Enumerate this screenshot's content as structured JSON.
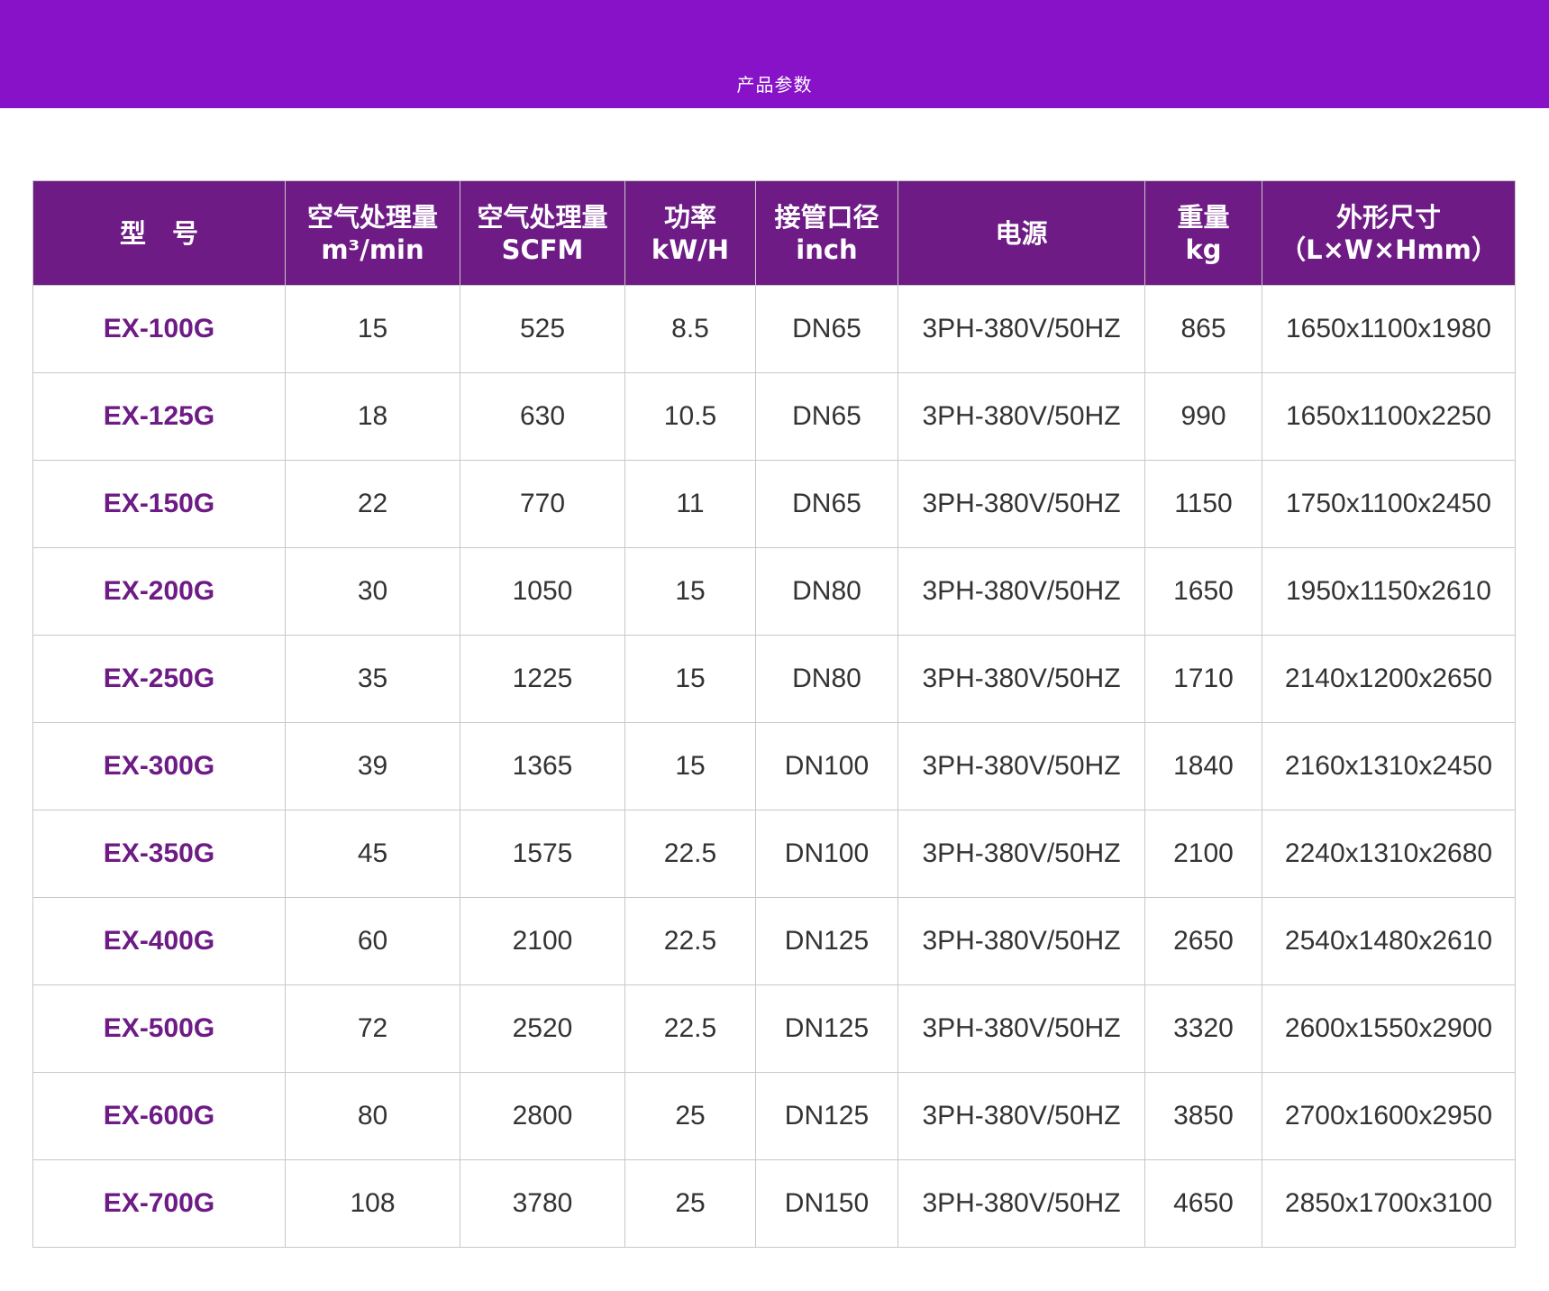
{
  "page": {
    "banner_title": "产品参数"
  },
  "accent_color": "#6e1b86",
  "banner_color": "#8812c8",
  "table": {
    "headers": [
      {
        "line1": "型　号",
        "line2": ""
      },
      {
        "line1": "空气处理量",
        "line2": "m³/min"
      },
      {
        "line1": "空气处理量",
        "line2": "SCFM"
      },
      {
        "line1": "功率",
        "line2": "kW/H"
      },
      {
        "line1": "接管口径",
        "line2": "inch"
      },
      {
        "line1": "电源",
        "line2": ""
      },
      {
        "line1": "重量",
        "line2": "kg"
      },
      {
        "line1": "外形尺寸",
        "line2": "（L×W×Hmm）"
      }
    ],
    "rows": [
      [
        "EX-100G",
        "15",
        "525",
        "8.5",
        "DN65",
        "3PH-380V/50HZ",
        "865",
        "1650x1100x1980"
      ],
      [
        "EX-125G",
        "18",
        "630",
        "10.5",
        "DN65",
        "3PH-380V/50HZ",
        "990",
        "1650x1100x2250"
      ],
      [
        "EX-150G",
        "22",
        "770",
        "11",
        "DN65",
        "3PH-380V/50HZ",
        "1150",
        "1750x1100x2450"
      ],
      [
        "EX-200G",
        "30",
        "1050",
        "15",
        "DN80",
        "3PH-380V/50HZ",
        "1650",
        "1950x1150x2610"
      ],
      [
        "EX-250G",
        "35",
        "1225",
        "15",
        "DN80",
        "3PH-380V/50HZ",
        "1710",
        "2140x1200x2650"
      ],
      [
        "EX-300G",
        "39",
        "1365",
        "15",
        "DN100",
        "3PH-380V/50HZ",
        "1840",
        "2160x1310x2450"
      ],
      [
        "EX-350G",
        "45",
        "1575",
        "22.5",
        "DN100",
        "3PH-380V/50HZ",
        "2100",
        "2240x1310x2680"
      ],
      [
        "EX-400G",
        "60",
        "2100",
        "22.5",
        "DN125",
        "3PH-380V/50HZ",
        "2650",
        "2540x1480x2610"
      ],
      [
        "EX-500G",
        "72",
        "2520",
        "22.5",
        "DN125",
        "3PH-380V/50HZ",
        "3320",
        "2600x1550x2900"
      ],
      [
        "EX-600G",
        "80",
        "2800",
        "25",
        "DN125",
        "3PH-380V/50HZ",
        "3850",
        "2700x1600x2950"
      ],
      [
        "EX-700G",
        "108",
        "3780",
        "25",
        "DN150",
        "3PH-380V/50HZ",
        "4650",
        "2850x1700x3100"
      ]
    ]
  }
}
